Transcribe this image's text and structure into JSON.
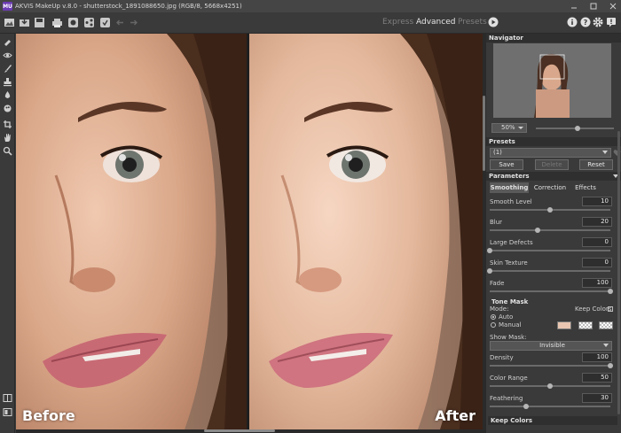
{
  "window": {
    "logo_text": "MU",
    "title": "AKVIS MakeUp v.8.0 - shutterstock_1891088650.jpg (RGB/8, 5668x4251)",
    "controls": [
      "minimize-icon",
      "maximize-icon",
      "close-icon"
    ]
  },
  "toolbar": {
    "buttons": [
      "open-image-icon",
      "save-image-icon",
      "print-icon",
      "batch-icon",
      "share-icon",
      "plugin-settings-icon",
      "undo-icon",
      "redo-icon"
    ],
    "modes": {
      "express": "Express",
      "advanced": "Advanced",
      "presets": "Presets"
    },
    "active_mode": "Advanced",
    "right_buttons": [
      "info-icon",
      "help-icon",
      "settings-icon",
      "notification-icon"
    ]
  },
  "tools": [
    "eraser-icon",
    "eye-icon",
    "brush-icon",
    "stamp-icon",
    "drop-icon",
    "color-brush-icon",
    "crop-icon",
    "hand-icon",
    "zoom-icon"
  ],
  "view_modes": [
    "split-view-icon",
    "compare-view-icon"
  ],
  "canvas": {
    "before_label": "Before",
    "after_label": "After"
  },
  "navigator": {
    "title": "Navigator",
    "zoom": "50%",
    "zoom_level": 0.5
  },
  "presets": {
    "title": "Presets",
    "selected": "(1)",
    "save_label": "Save",
    "delete_label": "Delete",
    "reset_label": "Reset"
  },
  "parameters": {
    "title": "Parameters",
    "tabs": [
      "Smoothing",
      "Correction",
      "Effects"
    ],
    "active_tab": "Smoothing",
    "sliders": [
      {
        "label": "Smooth Level",
        "value": "10",
        "fraction": 0.5
      },
      {
        "label": "Blur",
        "value": "20",
        "fraction": 0.4
      },
      {
        "label": "Large Defects",
        "value": "0",
        "fraction": 0.0
      },
      {
        "label": "Skin Texture",
        "value": "0",
        "fraction": 0.0
      },
      {
        "label": "Fade",
        "value": "100",
        "fraction": 1.0
      }
    ]
  },
  "tone_mask": {
    "title": "Tone Mask",
    "mode_label": "Mode:",
    "keep_colors_label": "Keep Colors",
    "auto_label": "Auto",
    "manual_label": "Manual",
    "selected_mode": "Auto",
    "swatch_color": "#e8c6b2",
    "show_mask_label": "Show Mask:",
    "show_mask_value": "Invisible",
    "sliders": [
      {
        "label": "Density",
        "value": "100",
        "fraction": 1.0
      },
      {
        "label": "Color Range",
        "value": "50",
        "fraction": 0.5
      },
      {
        "label": "Feathering",
        "value": "30",
        "fraction": 0.3
      }
    ]
  },
  "keep_colors_section": {
    "title": "Keep Colors"
  }
}
